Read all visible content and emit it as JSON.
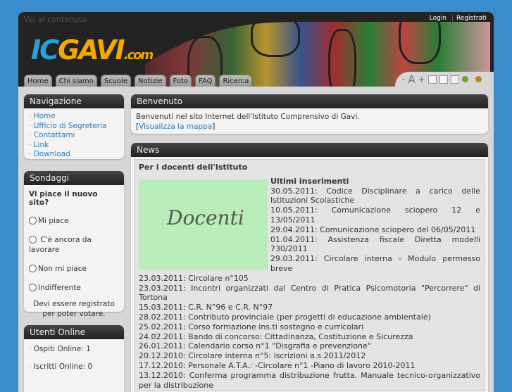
{
  "header": {
    "skip_link": "Vai al contenuto",
    "login": "Login",
    "register": "Registrati",
    "logo_ic": "IC",
    "logo_gavi": "GAVI",
    "logo_com": ".com"
  },
  "tabs": [
    "Home",
    "Chi siamo",
    "Scuole",
    "Notizie",
    "Foto",
    "FAQ",
    "Ricerca"
  ],
  "tools": {
    "minus": "-",
    "a": "A",
    "plus": "+"
  },
  "colors": {
    "background": "#3a8dcc",
    "header": "#232323",
    "link": "#2a7ab8",
    "green_dot": "#7aa020",
    "orange_dot": "#c08020"
  },
  "nav": {
    "title": "Navigazione",
    "items": [
      "Home",
      "Ufficio di Segreteria",
      "Contattami",
      "Link",
      "Download"
    ]
  },
  "poll": {
    "title": "Sondaggi",
    "question": "Vi piace il nuovo sito?",
    "options": [
      "Mi piace",
      "C'è ancora da lavorare",
      "Non mi piace",
      "Indifferente"
    ],
    "note": "Devi essere registrato per poter votare."
  },
  "online": {
    "title": "Utenti Online",
    "guests": "Ospiti Online: 1",
    "members": "Iscritti Online: 0"
  },
  "welcome": {
    "title": "Benvenuto",
    "text": "Benvenuti nel sito Internet dell'Istituto Comprensivo di Gavi.",
    "link": "Visualizza la mappa"
  },
  "news": {
    "title": "News",
    "heading": "Per i docenti dell'Istituto",
    "image_text": "Docenti",
    "latest": "Ultimi inserimenti",
    "side_items": [
      "30.05.2011: Codice Disciplinare a carico delle Istituzioni Scolastiche",
      "10.05.2011: Comunicazione sciopero 12 e 13/05/2011",
      "29.04.2011: Comunicazione sciopero del 06/05/2011",
      "01.04.2011: Assistenza fiscale Diretta modelli 730/2011",
      "29.03.2011: Circolare interna - Modulo permesso breve"
    ],
    "items": [
      "23.03.2011: Circolare n°105",
      "23.03.2011: Incontri organizzati dal Centro di Pratica Psicomotoria \"Percorrere\" di Tortona",
      "15.03.2011: C.R. N°96 e C.R. N°97",
      "28.02.2011: Contributo provinciale (per progetti di educazione ambientale)",
      "25.02.2011: Corso formazione ins.ti sostegno e curricolari",
      "24.02.2011: Bando di concorso: Cittadinanza, Costituzione e Sicurezza",
      "26.01.2011: Calendario corso n°1 \"Disgrafia e prevenzione\"",
      "20.12.2010: Circolare interna n°5: iscrizioni a.s.2011/2012",
      "17.12.2010: Personale A.T.A.: -Circolare n°1 -Piano di lavoro 2010-2011",
      "13.12.2010: Conferma programma distribuzione frutta. Manuale tecnico-organizzativo per la distribuzione"
    ]
  }
}
